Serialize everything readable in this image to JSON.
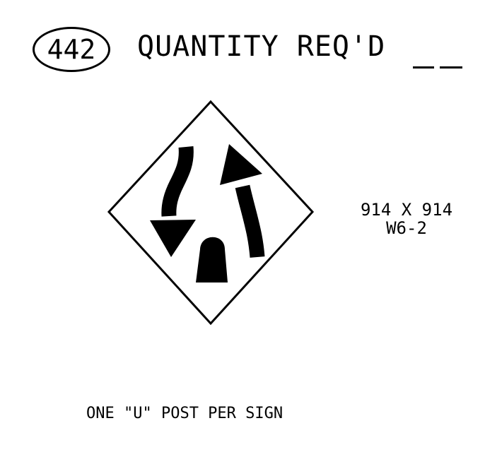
{
  "header": {
    "sign_number": "442",
    "quantity_label": "QUANTITY REQ'D"
  },
  "sign": {
    "size": "914 X 914",
    "code": "W6-2",
    "icon": "divided-highway-ends-icon"
  },
  "note": {
    "text": "ONE \"U\" POST PER SIGN"
  },
  "colors": {
    "ink": "#000000",
    "background": "#ffffff"
  }
}
